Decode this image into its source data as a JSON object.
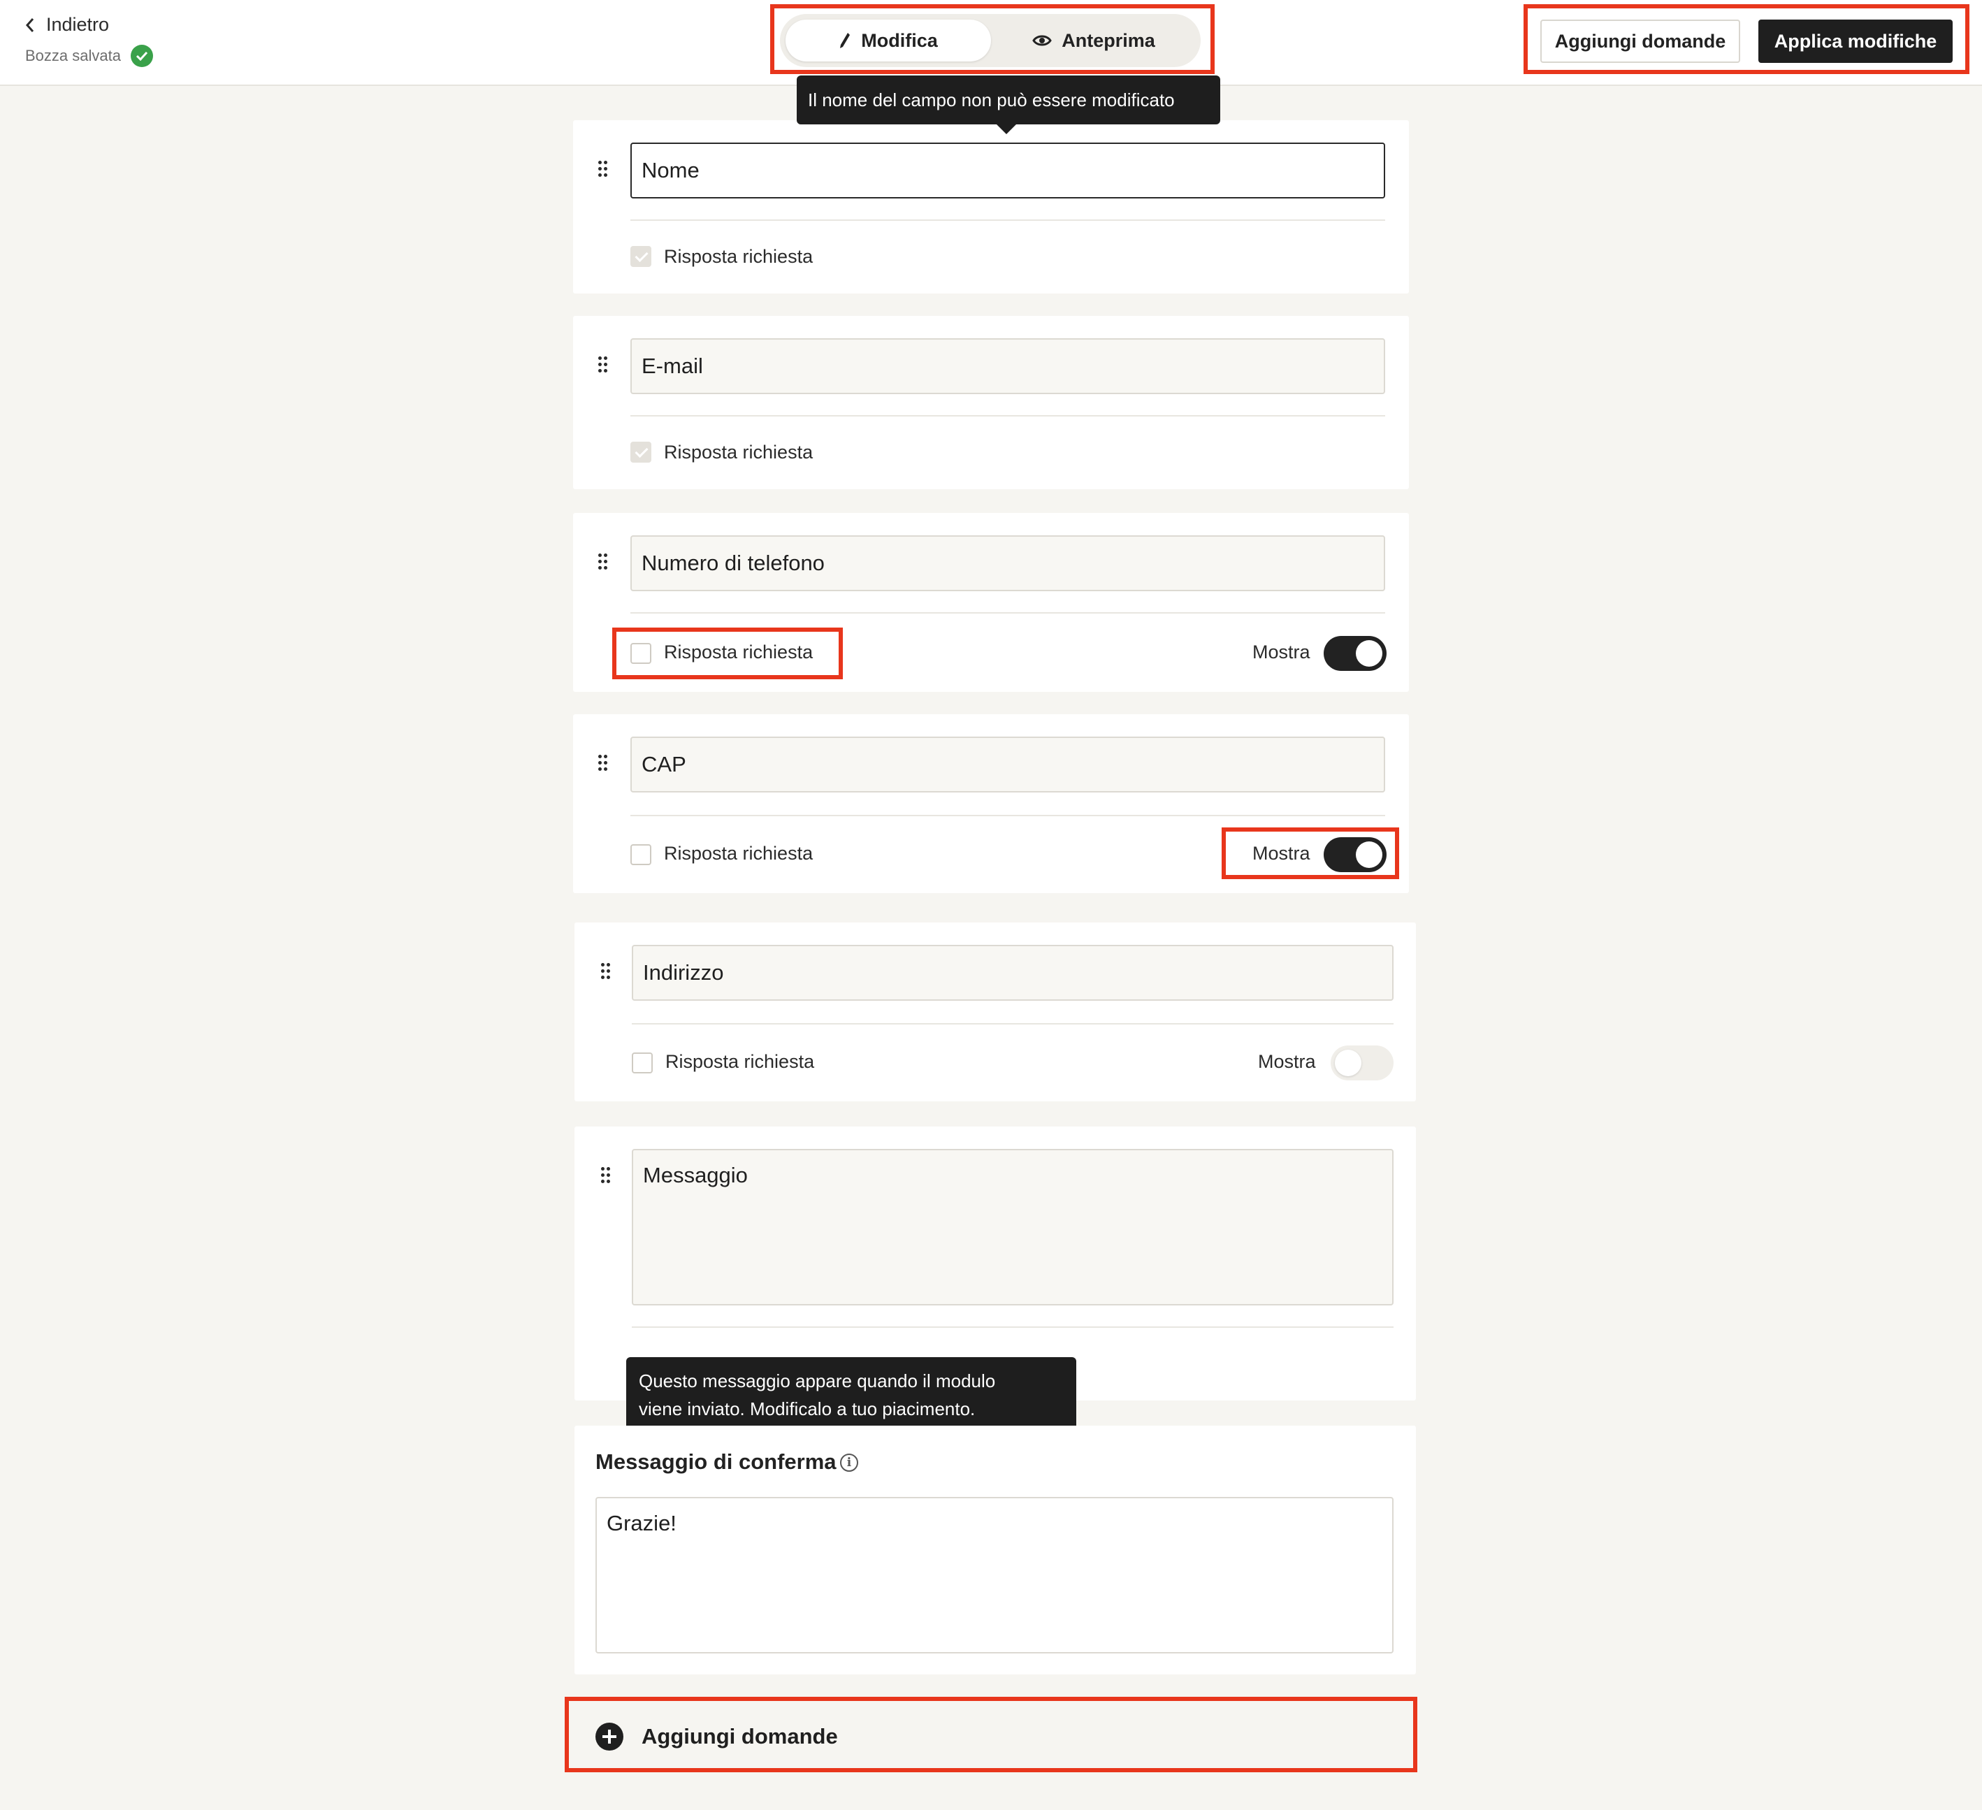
{
  "header": {
    "back_label": "Indietro",
    "draft_status": "Bozza salvata",
    "tabs": [
      {
        "label": "Modifica",
        "icon": "pencil-icon",
        "active": true
      },
      {
        "label": "Anteprima",
        "icon": "eye-icon",
        "active": false
      }
    ],
    "add_questions_label": "Aggiungi domande",
    "apply_changes_label": "Applica modifiche"
  },
  "tooltip_field_name": "Il nome del campo non può essere modificato",
  "fields": [
    {
      "name": "Nome",
      "required_label": "Risposta richiesta",
      "required": true,
      "required_locked": true
    },
    {
      "name": "E-mail",
      "required_label": "Risposta richiesta",
      "required": true,
      "required_locked": true
    },
    {
      "name": "Numero di telefono",
      "required_label": "Risposta richiesta",
      "required": false,
      "show_label": "Mostra",
      "show": true
    },
    {
      "name": "CAP",
      "required_label": "Risposta richiesta",
      "required": false,
      "show_label": "Mostra",
      "show": true
    },
    {
      "name": "Indirizzo",
      "required_label": "Risposta richiesta",
      "required": false,
      "show_label": "Mostra",
      "show": false
    },
    {
      "name": "Messaggio"
    }
  ],
  "tooltip_confirmation": {
    "line1": "Questo messaggio appare quando il modulo",
    "line2": "viene inviato. Modificalo a tuo piacimento."
  },
  "confirmation": {
    "title": "Messaggio di conferma",
    "value": "Grazie!"
  },
  "add_questions_bottom_label": "Aggiungi domande",
  "colors": {
    "highlight": "#e8361c",
    "dark": "#1f1f1f",
    "success": "#3aa14a",
    "background": "#f6f5f1"
  }
}
